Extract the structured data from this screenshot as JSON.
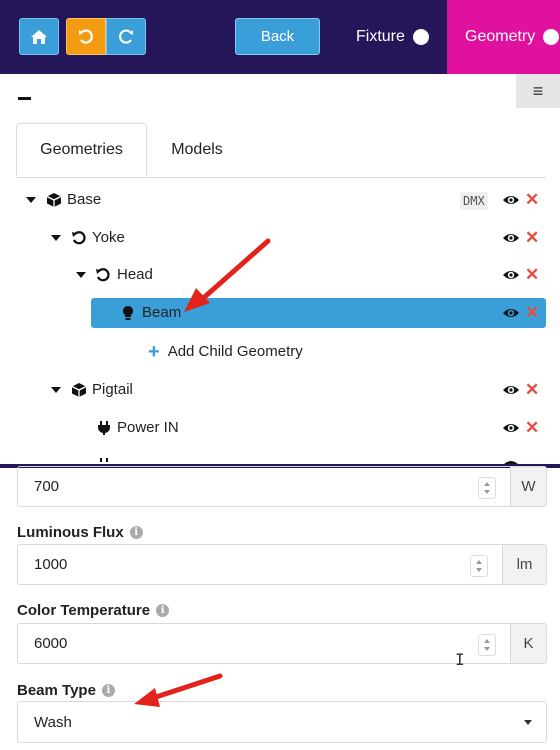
{
  "toolbar": {
    "home_icon": "home-icon",
    "undo_icon": "undo-icon",
    "redo_icon": "redo-icon",
    "back_label": "Back",
    "mode_fixture_label": "Fixture",
    "mode_geometry_label": "Geometry"
  },
  "tabs": [
    {
      "label": "Geometries",
      "active": true
    },
    {
      "label": "Models",
      "active": false
    }
  ],
  "tree": {
    "nodes": [
      {
        "label": "Base",
        "icon": "cube-icon",
        "expanded": true,
        "badge": "DMX"
      },
      {
        "label": "Yoke",
        "icon": "axis-rotate-icon",
        "expanded": true
      },
      {
        "label": "Head",
        "icon": "axis-rotate-icon",
        "expanded": true
      },
      {
        "label": "Beam",
        "icon": "lightbulb-icon",
        "selected": true
      },
      {
        "label": "Pigtail",
        "icon": "cube-icon",
        "expanded": true
      },
      {
        "label": "Power IN",
        "icon": "plug-icon"
      }
    ],
    "add_child_label": "Add Child Geometry"
  },
  "form": {
    "power": {
      "value": "700",
      "unit": "W"
    },
    "luminous_flux": {
      "label": "Luminous Flux",
      "value": "1000",
      "unit": "lm"
    },
    "color_temperature": {
      "label": "Color Temperature",
      "value": "6000",
      "unit": "K"
    },
    "beam_type": {
      "label": "Beam Type",
      "value": "Wash"
    }
  },
  "colors": {
    "topbar": "#25165a",
    "accent_blue": "#3a9fd8",
    "undo_orange": "#f39c12",
    "geometry_magenta": "#e0119e",
    "delete_red": "#e74c3c",
    "annotation_red": "#e3221b"
  }
}
